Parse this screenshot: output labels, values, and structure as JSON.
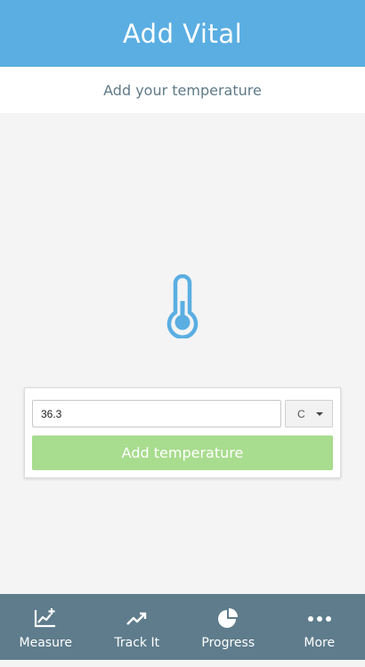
{
  "header": {
    "title": "Add Vital"
  },
  "subheader": {
    "text": "Add your temperature"
  },
  "icon": {
    "name": "thermometer-icon",
    "color": "#5aaee2"
  },
  "form": {
    "temperature_value": "36.3",
    "unit_selected": "C",
    "submit_label": "Add temperature"
  },
  "tabs": [
    {
      "label": "Measure",
      "icon": "chart-add-icon"
    },
    {
      "label": "Track It",
      "icon": "trending-up-icon"
    },
    {
      "label": "Progress",
      "icon": "pie-chart-icon"
    },
    {
      "label": "More",
      "icon": "more-dots-icon"
    }
  ],
  "colors": {
    "header_bg": "#5aaee2",
    "tabbar_bg": "#5e7c8c",
    "button_bg": "#a8dc8e",
    "page_bg": "#f4f4f4"
  }
}
